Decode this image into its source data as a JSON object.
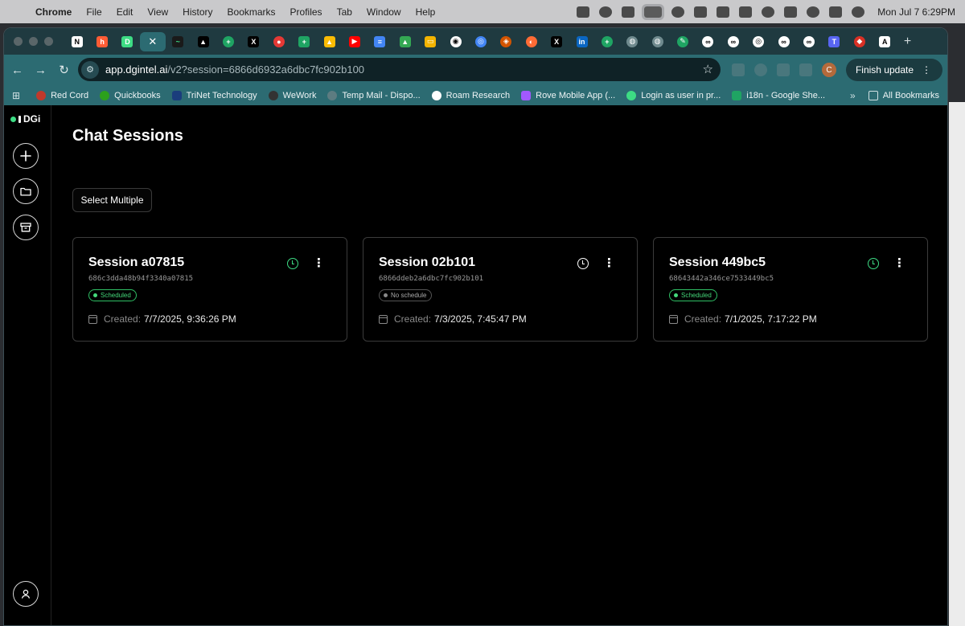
{
  "menubar": {
    "app": "Chrome",
    "items": [
      "File",
      "Edit",
      "View",
      "History",
      "Bookmarks",
      "Profiles",
      "Tab",
      "Window",
      "Help"
    ],
    "clock": "Mon Jul 7  6:29PM"
  },
  "browser": {
    "url_host": "app.dgintel.ai",
    "url_path": "/v2?session=6866d6932a6dbc7fc902b100",
    "finish_update": "Finish update",
    "avatar_letter": "C"
  },
  "bookmarks": [
    "Red Cord",
    "Quickbooks",
    "TriNet Technology",
    "WeWork",
    "Temp Mail - Dispo...",
    "Roam Research",
    "Rove Mobile App (...",
    "Login as user in pr...",
    "i18n - Google She..."
  ],
  "all_bookmarks": "All Bookmarks",
  "app": {
    "logo": "DGi",
    "page_title": "Chat Sessions",
    "select_multiple": "Select Multiple",
    "created_label": "Created:",
    "sessions": [
      {
        "title": "Session a07815",
        "id": "686c3dda48b94f3340a07815",
        "status": "Scheduled",
        "created": "7/7/2025, 9:36:26 PM"
      },
      {
        "title": "Session 02b101",
        "id": "6866ddeb2a6dbc7fc902b101",
        "status": "No schedule",
        "created": "7/3/2025, 7:45:47 PM"
      },
      {
        "title": "Session 449bc5",
        "id": "68643442a346ce7533449bc5",
        "status": "Scheduled",
        "created": "7/1/2025, 7:17:22 PM"
      }
    ]
  },
  "colors": {
    "accent_green": "#3ddc84",
    "toolbar": "#2c6b72",
    "background": "#000000"
  }
}
